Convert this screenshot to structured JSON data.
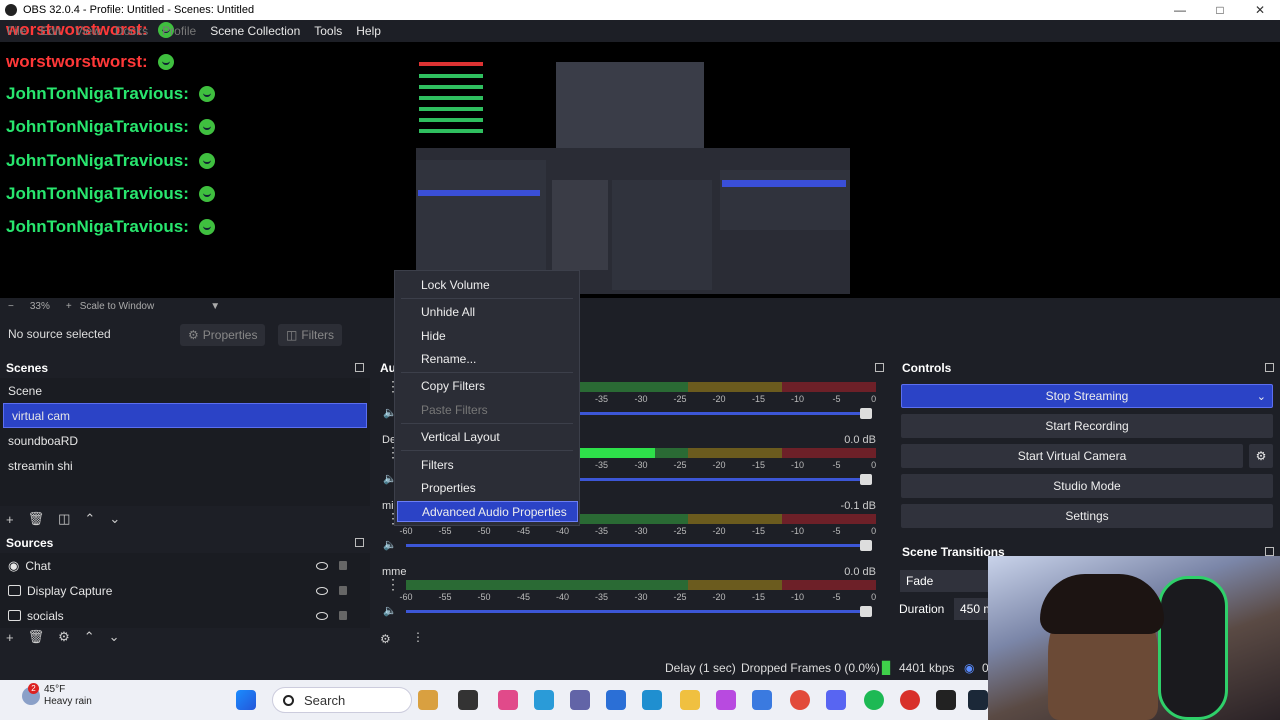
{
  "window": {
    "title": "OBS 32.0.4 - Profile: Untitled - Scenes: Untitled"
  },
  "menu": {
    "file": "File",
    "edit": "Edit",
    "view": "View",
    "docks": "Docks",
    "profile": "Profile",
    "scene_collection": "Scene Collection",
    "tools": "Tools",
    "help": "Help"
  },
  "chat": {
    "lines": [
      {
        "user": "worstworstworst:",
        "color": "red"
      },
      {
        "user": "worstworstworst:",
        "color": "red"
      },
      {
        "user": "JohnTonNigaTravious:",
        "color": "green"
      },
      {
        "user": "JohnTonNigaTravious:",
        "color": "green"
      },
      {
        "user": "JohnTonNigaTravious:",
        "color": "green"
      },
      {
        "user": "JohnTonNigaTravious:",
        "color": "green"
      },
      {
        "user": "JohnTonNigaTravious:",
        "color": "green"
      }
    ]
  },
  "zoom": {
    "minus": "−",
    "level": "33%",
    "plus": "+",
    "mode": "Scale to Window"
  },
  "source_bar": {
    "no_source": "No source selected",
    "properties": "Properties",
    "filters": "Filters"
  },
  "scenes": {
    "title": "Scenes",
    "items": [
      "Scene",
      "virtual cam",
      "soundboaRD",
      "streamin shi"
    ],
    "selected_index": 1
  },
  "sources": {
    "title": "Sources",
    "items": [
      "Chat",
      "Display Capture",
      "socials"
    ]
  },
  "mixer": {
    "title": "Au",
    "channels": [
      {
        "name": "",
        "db": "",
        "level": 0.0
      },
      {
        "name": "De",
        "db": "0.0 dB",
        "level": 0.53
      },
      {
        "name": "mi",
        "db": "-0.1 dB",
        "level": 0.0
      },
      {
        "name": "mme",
        "db": "0.0 dB",
        "level": 0.0
      }
    ],
    "scale": [
      "-60",
      "-55",
      "-50",
      "-45",
      "-40",
      "-35",
      "-30",
      "-25",
      "-20",
      "-15",
      "-10",
      "-5",
      "0"
    ]
  },
  "context_menu": {
    "items": [
      {
        "label": "Lock Volume",
        "state": "normal"
      },
      {
        "label": "Unhide All",
        "state": "normal"
      },
      {
        "label": "Hide",
        "state": "normal"
      },
      {
        "label": "Rename...",
        "state": "normal"
      },
      {
        "label": "Copy Filters",
        "state": "normal"
      },
      {
        "label": "Paste Filters",
        "state": "disabled"
      },
      {
        "label": "Vertical Layout",
        "state": "normal"
      },
      {
        "label": "Filters",
        "state": "normal"
      },
      {
        "label": "Properties",
        "state": "normal"
      },
      {
        "label": "Advanced Audio Properties",
        "state": "highlighted"
      }
    ]
  },
  "controls": {
    "title": "Controls",
    "stop_streaming": "Stop Streaming",
    "start_recording": "Start Recording",
    "start_virtual_camera": "Start Virtual Camera",
    "studio_mode": "Studio Mode",
    "settings": "Settings"
  },
  "transitions": {
    "title": "Scene Transitions",
    "selected": "Fade",
    "duration_label": "Duration",
    "duration_value": "450 m"
  },
  "status": {
    "delay": "Delay (1 sec)",
    "dropped": "Dropped Frames 0 (0.0%)",
    "bitrate": "4401 kbps",
    "extra": "0"
  },
  "taskbar": {
    "weather_temp": "45°F",
    "weather_desc": "Heavy rain",
    "weather_badge": "2",
    "search": "Search"
  },
  "colors": {
    "accent": "#2b43c6",
    "bg": "#1d1f26",
    "meter_green": "#2ee04a"
  }
}
